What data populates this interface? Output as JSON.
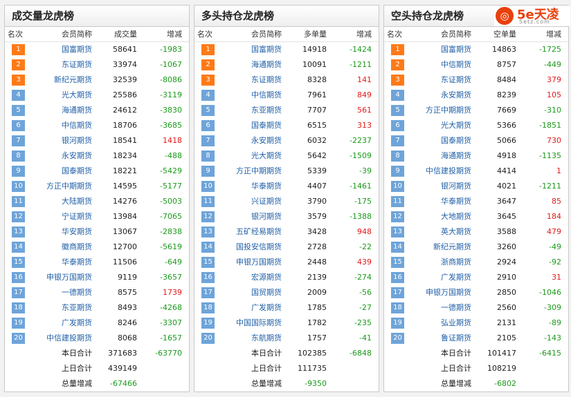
{
  "headers": {
    "rank": "名次",
    "member": "会员简称",
    "change": "增减"
  },
  "logo": {
    "icon_char": "◎",
    "main": "5e天凌",
    "sub": "5etz.com"
  },
  "panels": [
    {
      "title": "成交量龙虎榜",
      "volume_header": "成交量",
      "rows": [
        {
          "rank": "1",
          "name": "国富期货",
          "vol": "58641",
          "chg": "-1983"
        },
        {
          "rank": "2",
          "name": "东证期货",
          "vol": "33974",
          "chg": "-1067"
        },
        {
          "rank": "3",
          "name": "新纪元期货",
          "vol": "32539",
          "chg": "-8086"
        },
        {
          "rank": "4",
          "name": "光大期货",
          "vol": "25586",
          "chg": "-3119"
        },
        {
          "rank": "5",
          "name": "海通期货",
          "vol": "24612",
          "chg": "-3830"
        },
        {
          "rank": "6",
          "name": "中信期货",
          "vol": "18706",
          "chg": "-3685"
        },
        {
          "rank": "7",
          "name": "银河期货",
          "vol": "18541",
          "chg": "1418"
        },
        {
          "rank": "8",
          "name": "永安期货",
          "vol": "18234",
          "chg": "-488"
        },
        {
          "rank": "9",
          "name": "国泰期货",
          "vol": "18221",
          "chg": "-5429"
        },
        {
          "rank": "10",
          "name": "方正中期期货",
          "vol": "14595",
          "chg": "-5177"
        },
        {
          "rank": "11",
          "name": "大陆期货",
          "vol": "14276",
          "chg": "-5003"
        },
        {
          "rank": "12",
          "name": "宁证期货",
          "vol": "13984",
          "chg": "-7065"
        },
        {
          "rank": "13",
          "name": "华安期货",
          "vol": "13067",
          "chg": "-2838"
        },
        {
          "rank": "14",
          "name": "徽商期货",
          "vol": "12700",
          "chg": "-5619"
        },
        {
          "rank": "15",
          "name": "华泰期货",
          "vol": "11506",
          "chg": "-649"
        },
        {
          "rank": "16",
          "name": "申银万国期货",
          "vol": "9119",
          "chg": "-3657"
        },
        {
          "rank": "17",
          "name": "一德期货",
          "vol": "8575",
          "chg": "1739"
        },
        {
          "rank": "18",
          "name": "东亚期货",
          "vol": "8493",
          "chg": "-4268"
        },
        {
          "rank": "19",
          "name": "广发期货",
          "vol": "8246",
          "chg": "-3307"
        },
        {
          "rank": "20",
          "name": "中信建投期货",
          "vol": "8068",
          "chg": "-1657"
        }
      ],
      "today_label": "本日合计",
      "today_vol": "371683",
      "today_chg": "-63770",
      "prev_label": "上日合计",
      "prev_vol": "439149",
      "total_label": "总量增减",
      "total_chg": "-67466"
    },
    {
      "title": "多头持仓龙虎榜",
      "volume_header": "多单量",
      "rows": [
        {
          "rank": "1",
          "name": "国富期货",
          "vol": "14918",
          "chg": "-1424"
        },
        {
          "rank": "2",
          "name": "海通期货",
          "vol": "10091",
          "chg": "-1211"
        },
        {
          "rank": "3",
          "name": "东证期货",
          "vol": "8328",
          "chg": "141"
        },
        {
          "rank": "4",
          "name": "中信期货",
          "vol": "7961",
          "chg": "849"
        },
        {
          "rank": "5",
          "name": "东亚期货",
          "vol": "7707",
          "chg": "561"
        },
        {
          "rank": "6",
          "name": "国泰期货",
          "vol": "6515",
          "chg": "313"
        },
        {
          "rank": "7",
          "name": "永安期货",
          "vol": "6032",
          "chg": "-2237"
        },
        {
          "rank": "8",
          "name": "光大期货",
          "vol": "5642",
          "chg": "-1509"
        },
        {
          "rank": "9",
          "name": "方正中期期货",
          "vol": "5339",
          "chg": "-39"
        },
        {
          "rank": "10",
          "name": "华泰期货",
          "vol": "4407",
          "chg": "-1461"
        },
        {
          "rank": "11",
          "name": "兴证期货",
          "vol": "3790",
          "chg": "-175"
        },
        {
          "rank": "12",
          "name": "银河期货",
          "vol": "3579",
          "chg": "-1388"
        },
        {
          "rank": "13",
          "name": "五矿经易期货",
          "vol": "3428",
          "chg": "948"
        },
        {
          "rank": "14",
          "name": "国投安信期货",
          "vol": "2728",
          "chg": "-22"
        },
        {
          "rank": "15",
          "name": "申银万国期货",
          "vol": "2448",
          "chg": "439"
        },
        {
          "rank": "16",
          "name": "宏源期货",
          "vol": "2139",
          "chg": "-274"
        },
        {
          "rank": "17",
          "name": "国贸期货",
          "vol": "2009",
          "chg": "-56"
        },
        {
          "rank": "18",
          "name": "广发期货",
          "vol": "1785",
          "chg": "-27"
        },
        {
          "rank": "19",
          "name": "中国国际期货",
          "vol": "1782",
          "chg": "-235"
        },
        {
          "rank": "20",
          "name": "东航期货",
          "vol": "1757",
          "chg": "-41"
        }
      ],
      "today_label": "本日合计",
      "today_vol": "102385",
      "today_chg": "-6848",
      "prev_label": "上日合计",
      "prev_vol": "111735",
      "total_label": "总量增减",
      "total_chg": "-9350"
    },
    {
      "title": "空头持仓龙虎榜",
      "volume_header": "空单量",
      "rows": [
        {
          "rank": "1",
          "name": "国富期货",
          "vol": "14863",
          "chg": "-1725"
        },
        {
          "rank": "2",
          "name": "中信期货",
          "vol": "8757",
          "chg": "-449"
        },
        {
          "rank": "3",
          "name": "东证期货",
          "vol": "8484",
          "chg": "379"
        },
        {
          "rank": "4",
          "name": "永安期货",
          "vol": "8239",
          "chg": "105"
        },
        {
          "rank": "5",
          "name": "方正中期期货",
          "vol": "7669",
          "chg": "-310"
        },
        {
          "rank": "6",
          "name": "光大期货",
          "vol": "5366",
          "chg": "-1851"
        },
        {
          "rank": "7",
          "name": "国泰期货",
          "vol": "5066",
          "chg": "730"
        },
        {
          "rank": "8",
          "name": "海通期货",
          "vol": "4918",
          "chg": "-1135"
        },
        {
          "rank": "9",
          "name": "中信建投期货",
          "vol": "4414",
          "chg": "1"
        },
        {
          "rank": "10",
          "name": "银河期货",
          "vol": "4021",
          "chg": "-1211"
        },
        {
          "rank": "11",
          "name": "华泰期货",
          "vol": "3647",
          "chg": "85"
        },
        {
          "rank": "12",
          "name": "大地期货",
          "vol": "3645",
          "chg": "184"
        },
        {
          "rank": "13",
          "name": "英大期货",
          "vol": "3588",
          "chg": "479"
        },
        {
          "rank": "14",
          "name": "新纪元期货",
          "vol": "3260",
          "chg": "-49"
        },
        {
          "rank": "15",
          "name": "浙商期货",
          "vol": "2924",
          "chg": "-92"
        },
        {
          "rank": "16",
          "name": "广发期货",
          "vol": "2910",
          "chg": "31"
        },
        {
          "rank": "17",
          "name": "申银万国期货",
          "vol": "2850",
          "chg": "-1046"
        },
        {
          "rank": "18",
          "name": "一德期货",
          "vol": "2560",
          "chg": "-309"
        },
        {
          "rank": "19",
          "name": "弘业期货",
          "vol": "2131",
          "chg": "-89"
        },
        {
          "rank": "20",
          "name": "鲁证期货",
          "vol": "2105",
          "chg": "-143"
        }
      ],
      "today_label": "本日合计",
      "today_vol": "101417",
      "today_chg": "-6415",
      "prev_label": "上日合计",
      "prev_vol": "108219",
      "total_label": "总量增减",
      "total_chg": "-6802"
    }
  ]
}
